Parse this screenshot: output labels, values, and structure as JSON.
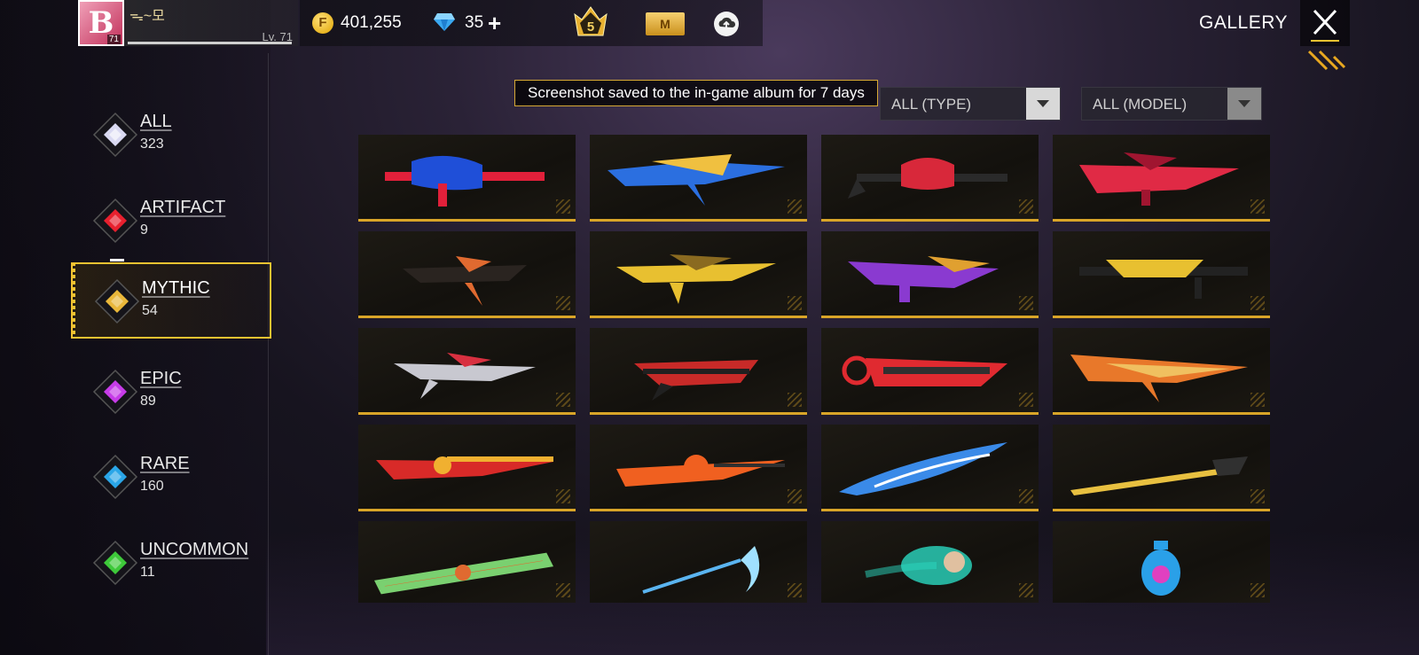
{
  "header": {
    "player_name": "ᯓ~모",
    "player_level": "Lv. 71",
    "avatar_level": "71",
    "avatar_glyph": "B",
    "coins": "401,255",
    "diamonds": "35",
    "rank_badge": "5",
    "pass_label": "M",
    "title": "GALLERY"
  },
  "toast": "Screenshot saved to the in-game album for 7 days",
  "filters": {
    "type": "ALL (TYPE)",
    "model": "ALL (MODEL)"
  },
  "categories": [
    {
      "name": "ALL",
      "count": "323",
      "color": "#d9d9f2"
    },
    {
      "name": "ARTIFACT",
      "count": "9",
      "color": "#e8202e"
    },
    {
      "name": "MYTHIC",
      "count": "54",
      "color": "#e9b73a"
    },
    {
      "name": "EPIC",
      "count": "89",
      "color": "#c73ce8"
    },
    {
      "name": "RARE",
      "count": "160",
      "color": "#2aa6e8"
    },
    {
      "name": "UNCOMMON",
      "count": "11",
      "color": "#3ec93a"
    }
  ],
  "selected_category": "MYTHIC",
  "items": [
    {
      "icon": "blue-monster-rifle-icon",
      "colors": [
        "#1f4fd8",
        "#e1203a"
      ]
    },
    {
      "icon": "blue-gold-blade-rifle-icon",
      "colors": [
        "#2b6fe0",
        "#f0c040"
      ]
    },
    {
      "icon": "red-skull-smg-icon",
      "colors": [
        "#d8283a",
        "#2a2a2a"
      ]
    },
    {
      "icon": "red-crystal-rifle-icon",
      "colors": [
        "#e02a45",
        "#a01530"
      ]
    },
    {
      "icon": "dark-orange-spiked-rifle-icon",
      "colors": [
        "#2a2420",
        "#e06a30"
      ]
    },
    {
      "icon": "gold-blade-rifle-icon",
      "colors": [
        "#e8c030",
        "#8a6a20"
      ]
    },
    {
      "icon": "purple-gold-smg-icon",
      "colors": [
        "#8a3ad0",
        "#e0a030"
      ]
    },
    {
      "icon": "gold-black-sniper-icon",
      "colors": [
        "#e8c030",
        "#222222"
      ]
    },
    {
      "icon": "silver-red-spiked-rifle-icon",
      "colors": [
        "#c8c8d0",
        "#d83040"
      ]
    },
    {
      "icon": "red-black-shotgun-icon",
      "colors": [
        "#c82a28",
        "#202020"
      ]
    },
    {
      "icon": "red-dragon-cannon-icon",
      "colors": [
        "#e02a30",
        "#303030"
      ]
    },
    {
      "icon": "fire-gold-rifle-icon",
      "colors": [
        "#e8782a",
        "#f0c060"
      ]
    },
    {
      "icon": "red-gold-flame-rifle-icon",
      "colors": [
        "#d82a28",
        "#f0b030"
      ]
    },
    {
      "icon": "orange-flame-blade-gun-icon",
      "colors": [
        "#f06020",
        "#303030"
      ]
    },
    {
      "icon": "blue-ice-blade-icon",
      "colors": [
        "#3a8ae8",
        "#ffffff"
      ]
    },
    {
      "icon": "golden-spear-icon",
      "colors": [
        "#e8c040",
        "#303030"
      ]
    },
    {
      "icon": "rolling-pin-melee-icon",
      "colors": [
        "#e06a30",
        "#7ad070"
      ]
    },
    {
      "icon": "ice-scythe-melee-icon",
      "colors": [
        "#5ab4f0",
        "#a0e0ff"
      ]
    },
    {
      "icon": "teal-energy-orb-icon",
      "colors": [
        "#2ad8c0",
        "#e0c0a0"
      ]
    },
    {
      "icon": "neon-grenade-icon",
      "colors": [
        "#2aa0e8",
        "#e040c0"
      ]
    }
  ]
}
